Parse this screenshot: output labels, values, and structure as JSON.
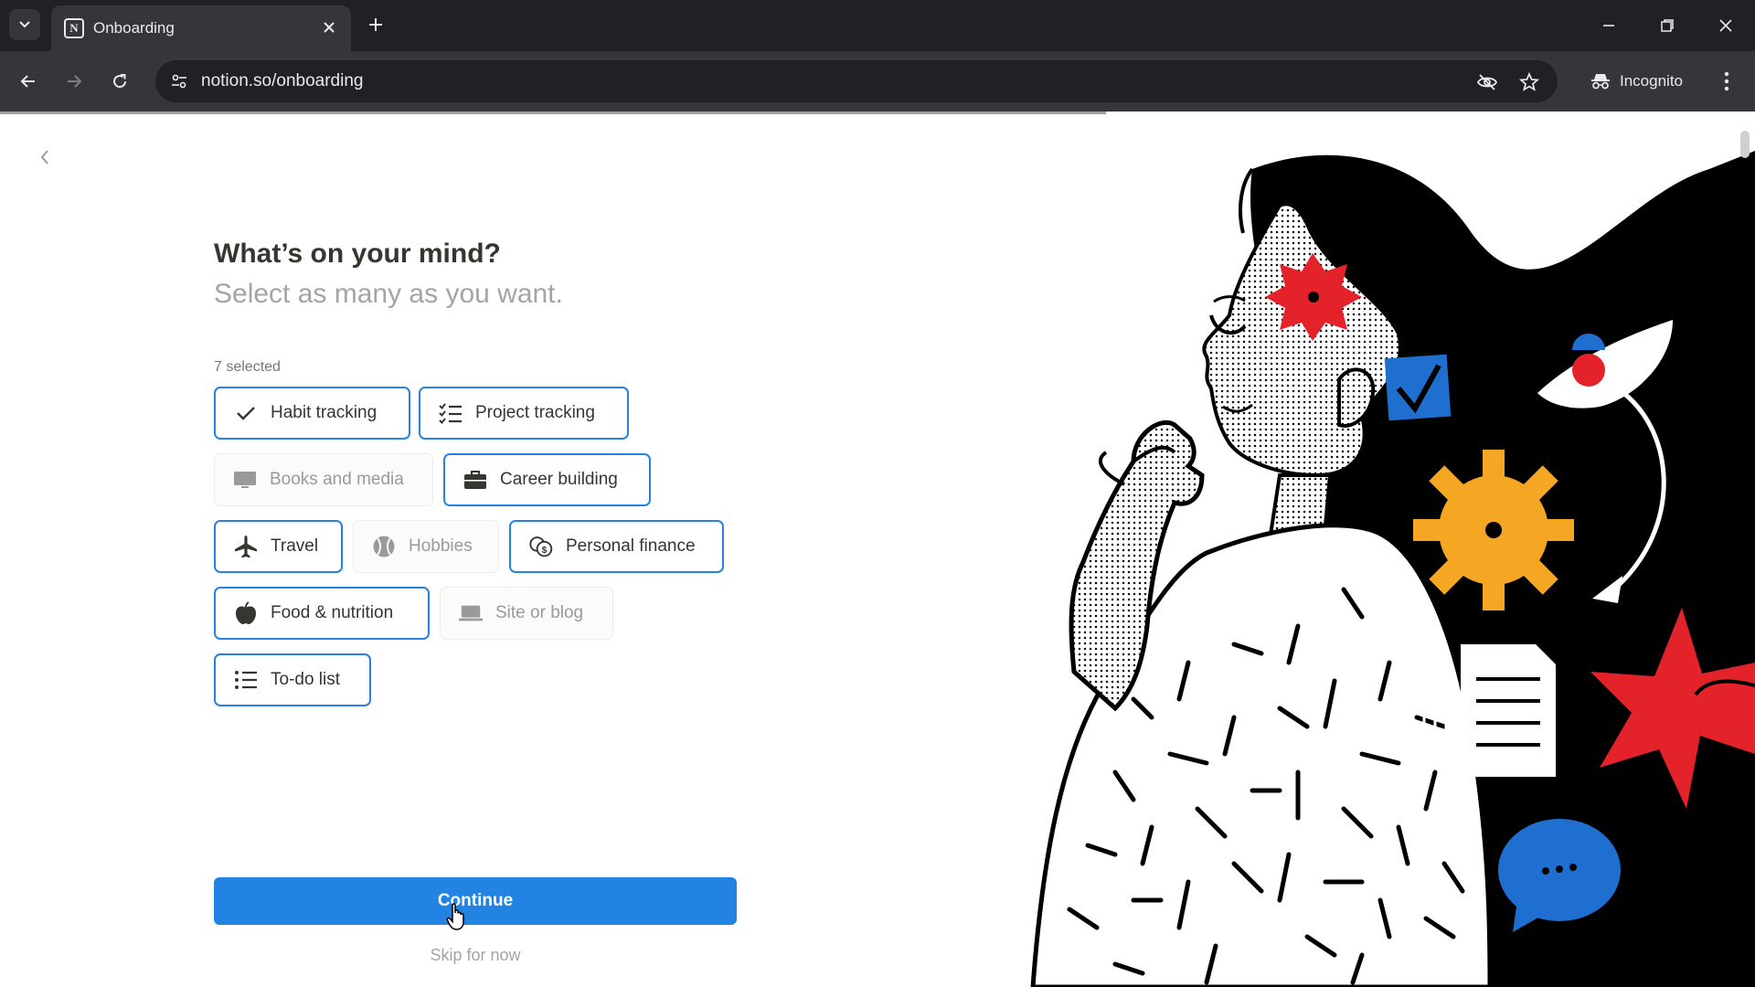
{
  "browser": {
    "tab_title": "Onboarding",
    "favicon_letter": "N",
    "url": "notion.so/onboarding",
    "profile_label": "Incognito",
    "loading_progress": 0.63
  },
  "onboarding": {
    "title": "What’s on your mind?",
    "subtitle": "Select as many as you want.",
    "selected_count": "7 selected",
    "chips": [
      {
        "label": "Habit tracking",
        "icon": "checkmark-icon",
        "selected": true
      },
      {
        "label": "Project tracking",
        "icon": "checklist-icon",
        "selected": true
      },
      {
        "label": "Books and media",
        "icon": "monitor-icon",
        "selected": false
      },
      {
        "label": "Career building",
        "icon": "briefcase-icon",
        "selected": true
      },
      {
        "label": "Travel",
        "icon": "airplane-icon",
        "selected": true
      },
      {
        "label": "Hobbies",
        "icon": "ball-icon",
        "selected": false
      },
      {
        "label": "Personal finance",
        "icon": "coins-icon",
        "selected": true
      },
      {
        "label": "Food & nutrition",
        "icon": "apple-icon",
        "selected": true
      },
      {
        "label": "Site or blog",
        "icon": "laptop-icon",
        "selected": false
      },
      {
        "label": "To-do list",
        "icon": "list-icon",
        "selected": true
      }
    ],
    "continue_label": "Continue",
    "skip_label": "Skip for now"
  },
  "colors": {
    "accent": "#2383e2",
    "chrome_dark": "#202124",
    "chrome_mid": "#35363a"
  }
}
